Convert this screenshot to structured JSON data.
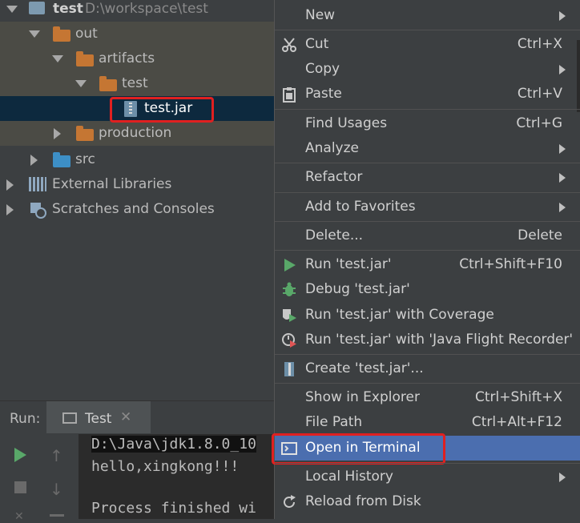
{
  "project_tree": {
    "root": {
      "name": "test",
      "path": "D:\\workspace\\test"
    },
    "items": [
      {
        "label": "out"
      },
      {
        "label": "artifacts"
      },
      {
        "label": "test"
      },
      {
        "label": "test.jar"
      },
      {
        "label": "production"
      },
      {
        "label": "src"
      },
      {
        "label": "External Libraries"
      },
      {
        "label": "Scratches and Consoles"
      }
    ]
  },
  "run_panel": {
    "label": "Run:",
    "tab": "Test",
    "console_lines": [
      "D:\\Java\\jdk1.8.0_10",
      "hello,xingkong!!!",
      "",
      "Process finished wi"
    ]
  },
  "context_menu": {
    "items": [
      {
        "label": "New",
        "shortcut": ""
      },
      {
        "label": "Cut",
        "shortcut": "Ctrl+X"
      },
      {
        "label": "Copy",
        "shortcut": ""
      },
      {
        "label": "Paste",
        "shortcut": "Ctrl+V"
      },
      {
        "label": "Find Usages",
        "shortcut": "Ctrl+G"
      },
      {
        "label": "Analyze",
        "shortcut": ""
      },
      {
        "label": "Refactor",
        "shortcut": ""
      },
      {
        "label": "Add to Favorites",
        "shortcut": ""
      },
      {
        "label": "Delete...",
        "shortcut": "Delete"
      },
      {
        "label": "Run 'test.jar'",
        "shortcut": "Ctrl+Shift+F10"
      },
      {
        "label": "Debug 'test.jar'",
        "shortcut": ""
      },
      {
        "label": "Run 'test.jar' with Coverage",
        "shortcut": ""
      },
      {
        "label": "Run 'test.jar' with 'Java Flight Recorder'",
        "shortcut": ""
      },
      {
        "label": "Create 'test.jar'...",
        "shortcut": ""
      },
      {
        "label": "Show in Explorer",
        "shortcut": "Ctrl+Shift+X"
      },
      {
        "label": "File Path",
        "shortcut": "Ctrl+Alt+F12"
      },
      {
        "label": "Open in Terminal",
        "shortcut": ""
      },
      {
        "label": "Local History",
        "shortcut": ""
      },
      {
        "label": "Reload from Disk",
        "shortcut": ""
      }
    ]
  },
  "colors": {
    "background": "#3c3f41",
    "selection": "#4b6eaf",
    "tree_selection": "#0d293e",
    "highlight_box": "#e02020",
    "folder": "#c57633",
    "source_folder": "#3d8fc6"
  }
}
